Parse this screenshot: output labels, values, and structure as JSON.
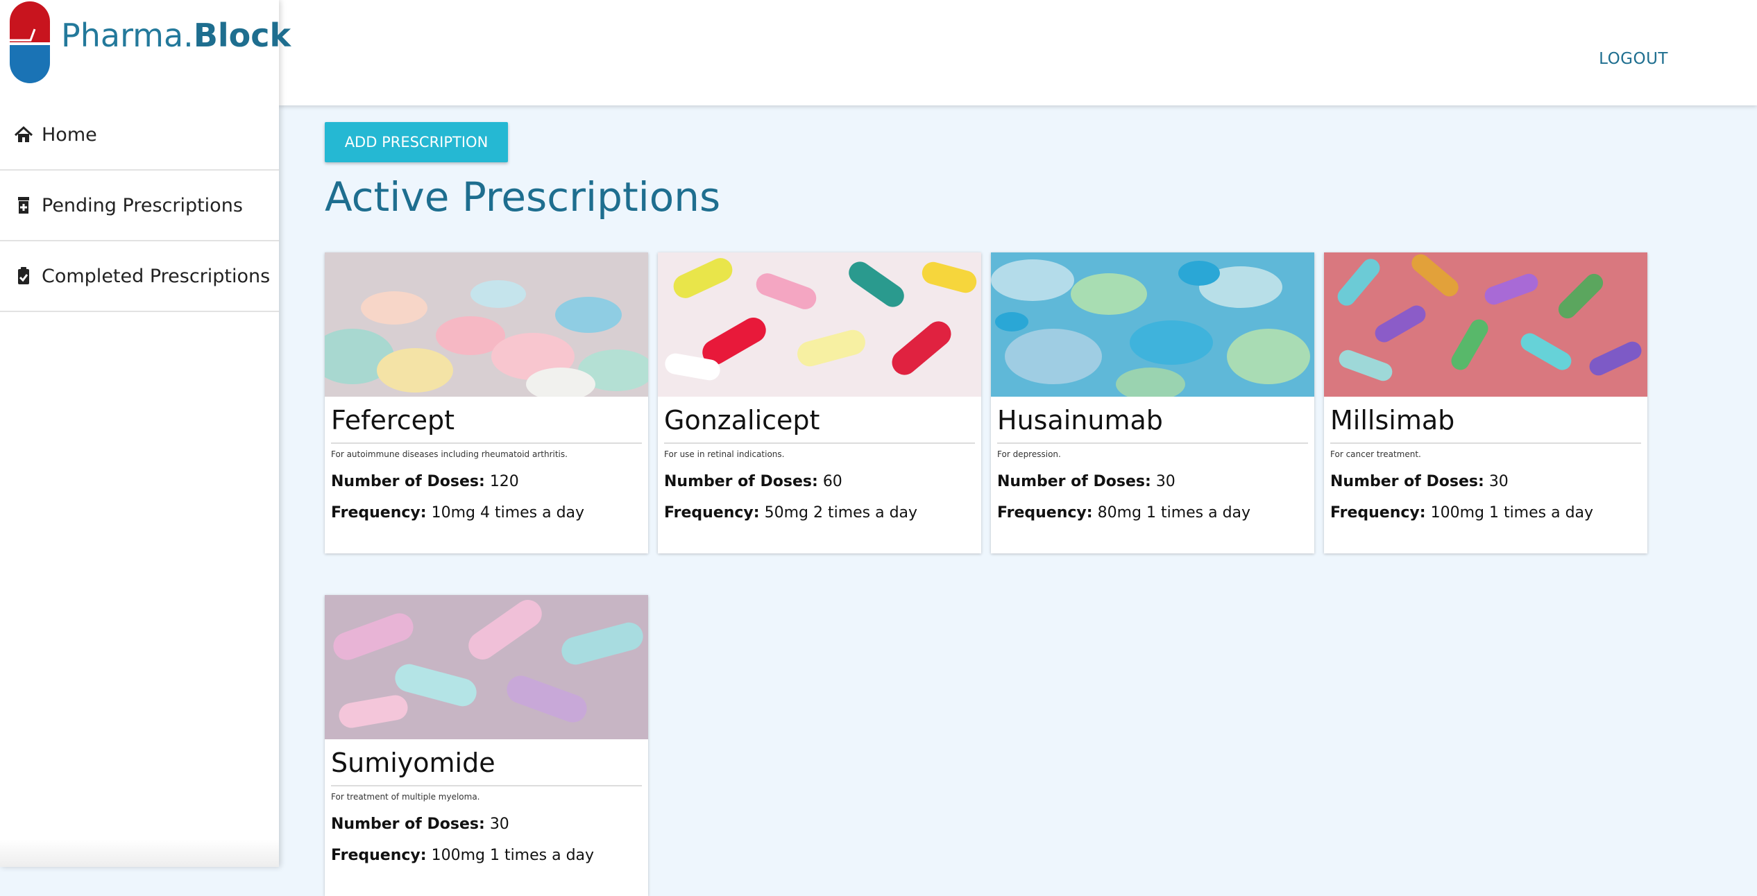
{
  "brand": {
    "name_light": "Pharma.",
    "name_bold": "Block"
  },
  "sidebar": {
    "items": [
      {
        "label": "Home",
        "icon": "home-icon"
      },
      {
        "label": "Pending Prescriptions",
        "icon": "prescription-bottle-icon"
      },
      {
        "label": "Completed Prescriptions",
        "icon": "clipboard-check-icon"
      }
    ]
  },
  "header": {
    "logout_label": "LOGOUT"
  },
  "main": {
    "add_button_label": "ADD PRESCRIPTION",
    "title": "Active Prescriptions",
    "doses_label": "Number of Doses:",
    "frequency_label": "Frequency:",
    "cards": [
      {
        "name": "Fefercept",
        "description": "For autoimmune diseases including rheumatoid arthritis.",
        "doses": "120",
        "frequency": "10mg 4 times a day"
      },
      {
        "name": "Gonzalicept",
        "description": "For use in retinal indications.",
        "doses": "60",
        "frequency": "50mg 2 times a day"
      },
      {
        "name": "Husainumab",
        "description": "For depression.",
        "doses": "30",
        "frequency": "80mg 1 times a day"
      },
      {
        "name": "Millsimab",
        "description": "For cancer treatment.",
        "doses": "30",
        "frequency": "100mg 1 times a day"
      },
      {
        "name": "Sumiyomide",
        "description": "For treatment of multiple myeloma.",
        "doses": "30",
        "frequency": "100mg 1 times a day"
      }
    ]
  },
  "colors": {
    "accent": "#1e6e8f",
    "button": "#25b8d3",
    "logo_red": "#c8141e",
    "logo_blue": "#1a73b5",
    "background": "#eef6fd"
  }
}
